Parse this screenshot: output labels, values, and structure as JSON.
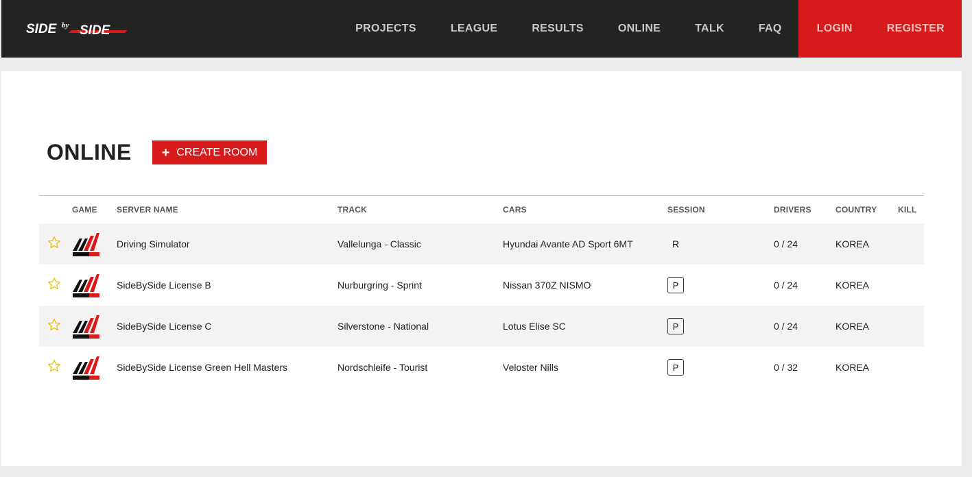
{
  "nav": {
    "items": [
      "PROJECTS",
      "LEAGUE",
      "RESULTS",
      "ONLINE",
      "TALK",
      "FAQ"
    ],
    "login": "LOGIN",
    "register": "REGISTER"
  },
  "page": {
    "title": "ONLINE",
    "create_button": "CREATE ROOM"
  },
  "table": {
    "headers": {
      "game": "GAME",
      "server": "SERVER NAME",
      "track": "TRACK",
      "cars": "CARS",
      "session": "SESSION",
      "drivers": "DRIVERS",
      "country": "COUNTRY",
      "kill": "KILL"
    },
    "rows": [
      {
        "server": "Driving Simulator",
        "track": "Vallelunga - Classic",
        "cars": "Hyundai Avante AD Sport 6MT",
        "session": "R",
        "drivers": "0 / 24",
        "country": "KOREA"
      },
      {
        "server": "SideBySide License B",
        "track": "Nurburgring - Sprint",
        "cars": "Nissan 370Z NISMO",
        "session": "P",
        "drivers": "0 / 24",
        "country": "KOREA"
      },
      {
        "server": "SideBySide License C",
        "track": "Silverstone - National",
        "cars": "Lotus Elise SC",
        "session": "P",
        "drivers": "0 / 24",
        "country": "KOREA"
      },
      {
        "server": "SideBySide License Green Hell Masters",
        "track": "Nordschleife - Tourist",
        "cars": "Veloster Nills",
        "session": "P",
        "drivers": "0 / 32",
        "country": "KOREA"
      }
    ]
  },
  "colors": {
    "accent": "#d71a1a",
    "topbar": "#232323",
    "star": "#f2c200"
  }
}
